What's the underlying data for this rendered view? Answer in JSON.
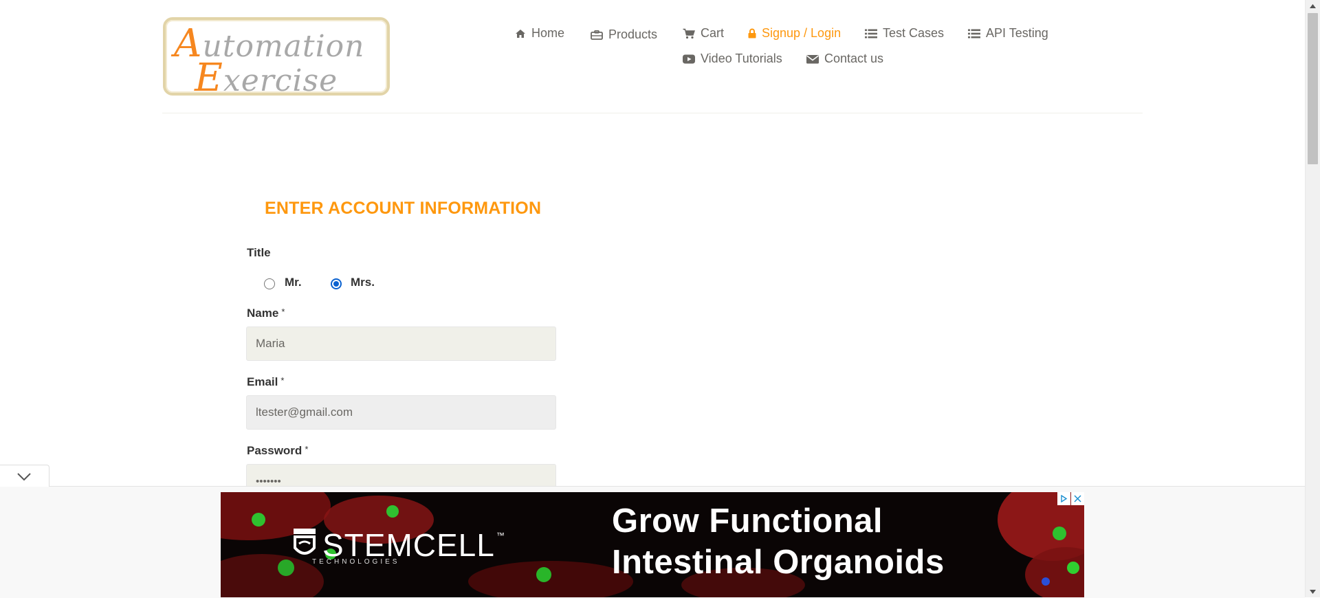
{
  "logo": {
    "alt": "Automation Exercise",
    "line1_cap": "A",
    "line1_rest": "utomation",
    "line2_cap": "E",
    "line2_rest": "xercise"
  },
  "nav": {
    "home": "Home",
    "products": "Products",
    "cart": "Cart",
    "signup_login": "Signup / Login",
    "test_cases": "Test Cases",
    "api_testing": "API Testing",
    "video_tutorials": "Video Tutorials",
    "contact_us": "Contact us"
  },
  "form": {
    "heading": "ENTER ACCOUNT INFORMATION",
    "title_label": "Title",
    "title_options": [
      "Mr.",
      "Mrs."
    ],
    "title_selected": "Mrs.",
    "name_label": "Name",
    "name_value": "Maria",
    "email_label": "Email",
    "email_value": "ltester@gmail.com",
    "password_label": "Password",
    "password_value": "•••••••",
    "required_mark": "*"
  },
  "ad": {
    "brand": "STEMCELL",
    "brand_tm": "™",
    "brand_sub": "TECHNOLOGIES",
    "headline_1": "Grow Functional",
    "headline_2": "Intestinal Organoids"
  },
  "colors": {
    "accent": "#fe980f",
    "text": "#696763",
    "radio_checked": "#0b62d0",
    "input_bg_name": "#f0f0e9",
    "input_bg_email": "#eeeeee"
  }
}
